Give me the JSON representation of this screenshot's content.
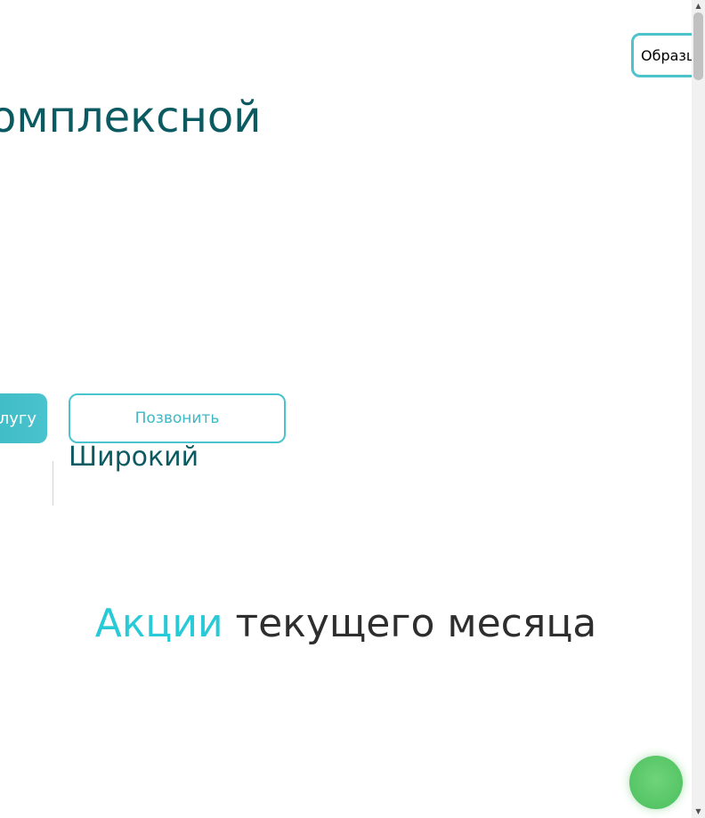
{
  "header": {
    "samples_label": "Образцы"
  },
  "hero": {
    "title": "комплексной",
    "order_button_label": "услугу",
    "call_button_label": "Позвонить",
    "feature_title": "Широкий"
  },
  "promotions": {
    "title_accent": "Акции",
    "title_rest": " текущего месяца"
  },
  "colors": {
    "accent": "#27cad6",
    "brand_dark": "#0b5a61",
    "chat": "#55c565"
  },
  "icons": {
    "scroll_up": "▲",
    "scroll_down": "▼",
    "chat": "chat-icon"
  }
}
